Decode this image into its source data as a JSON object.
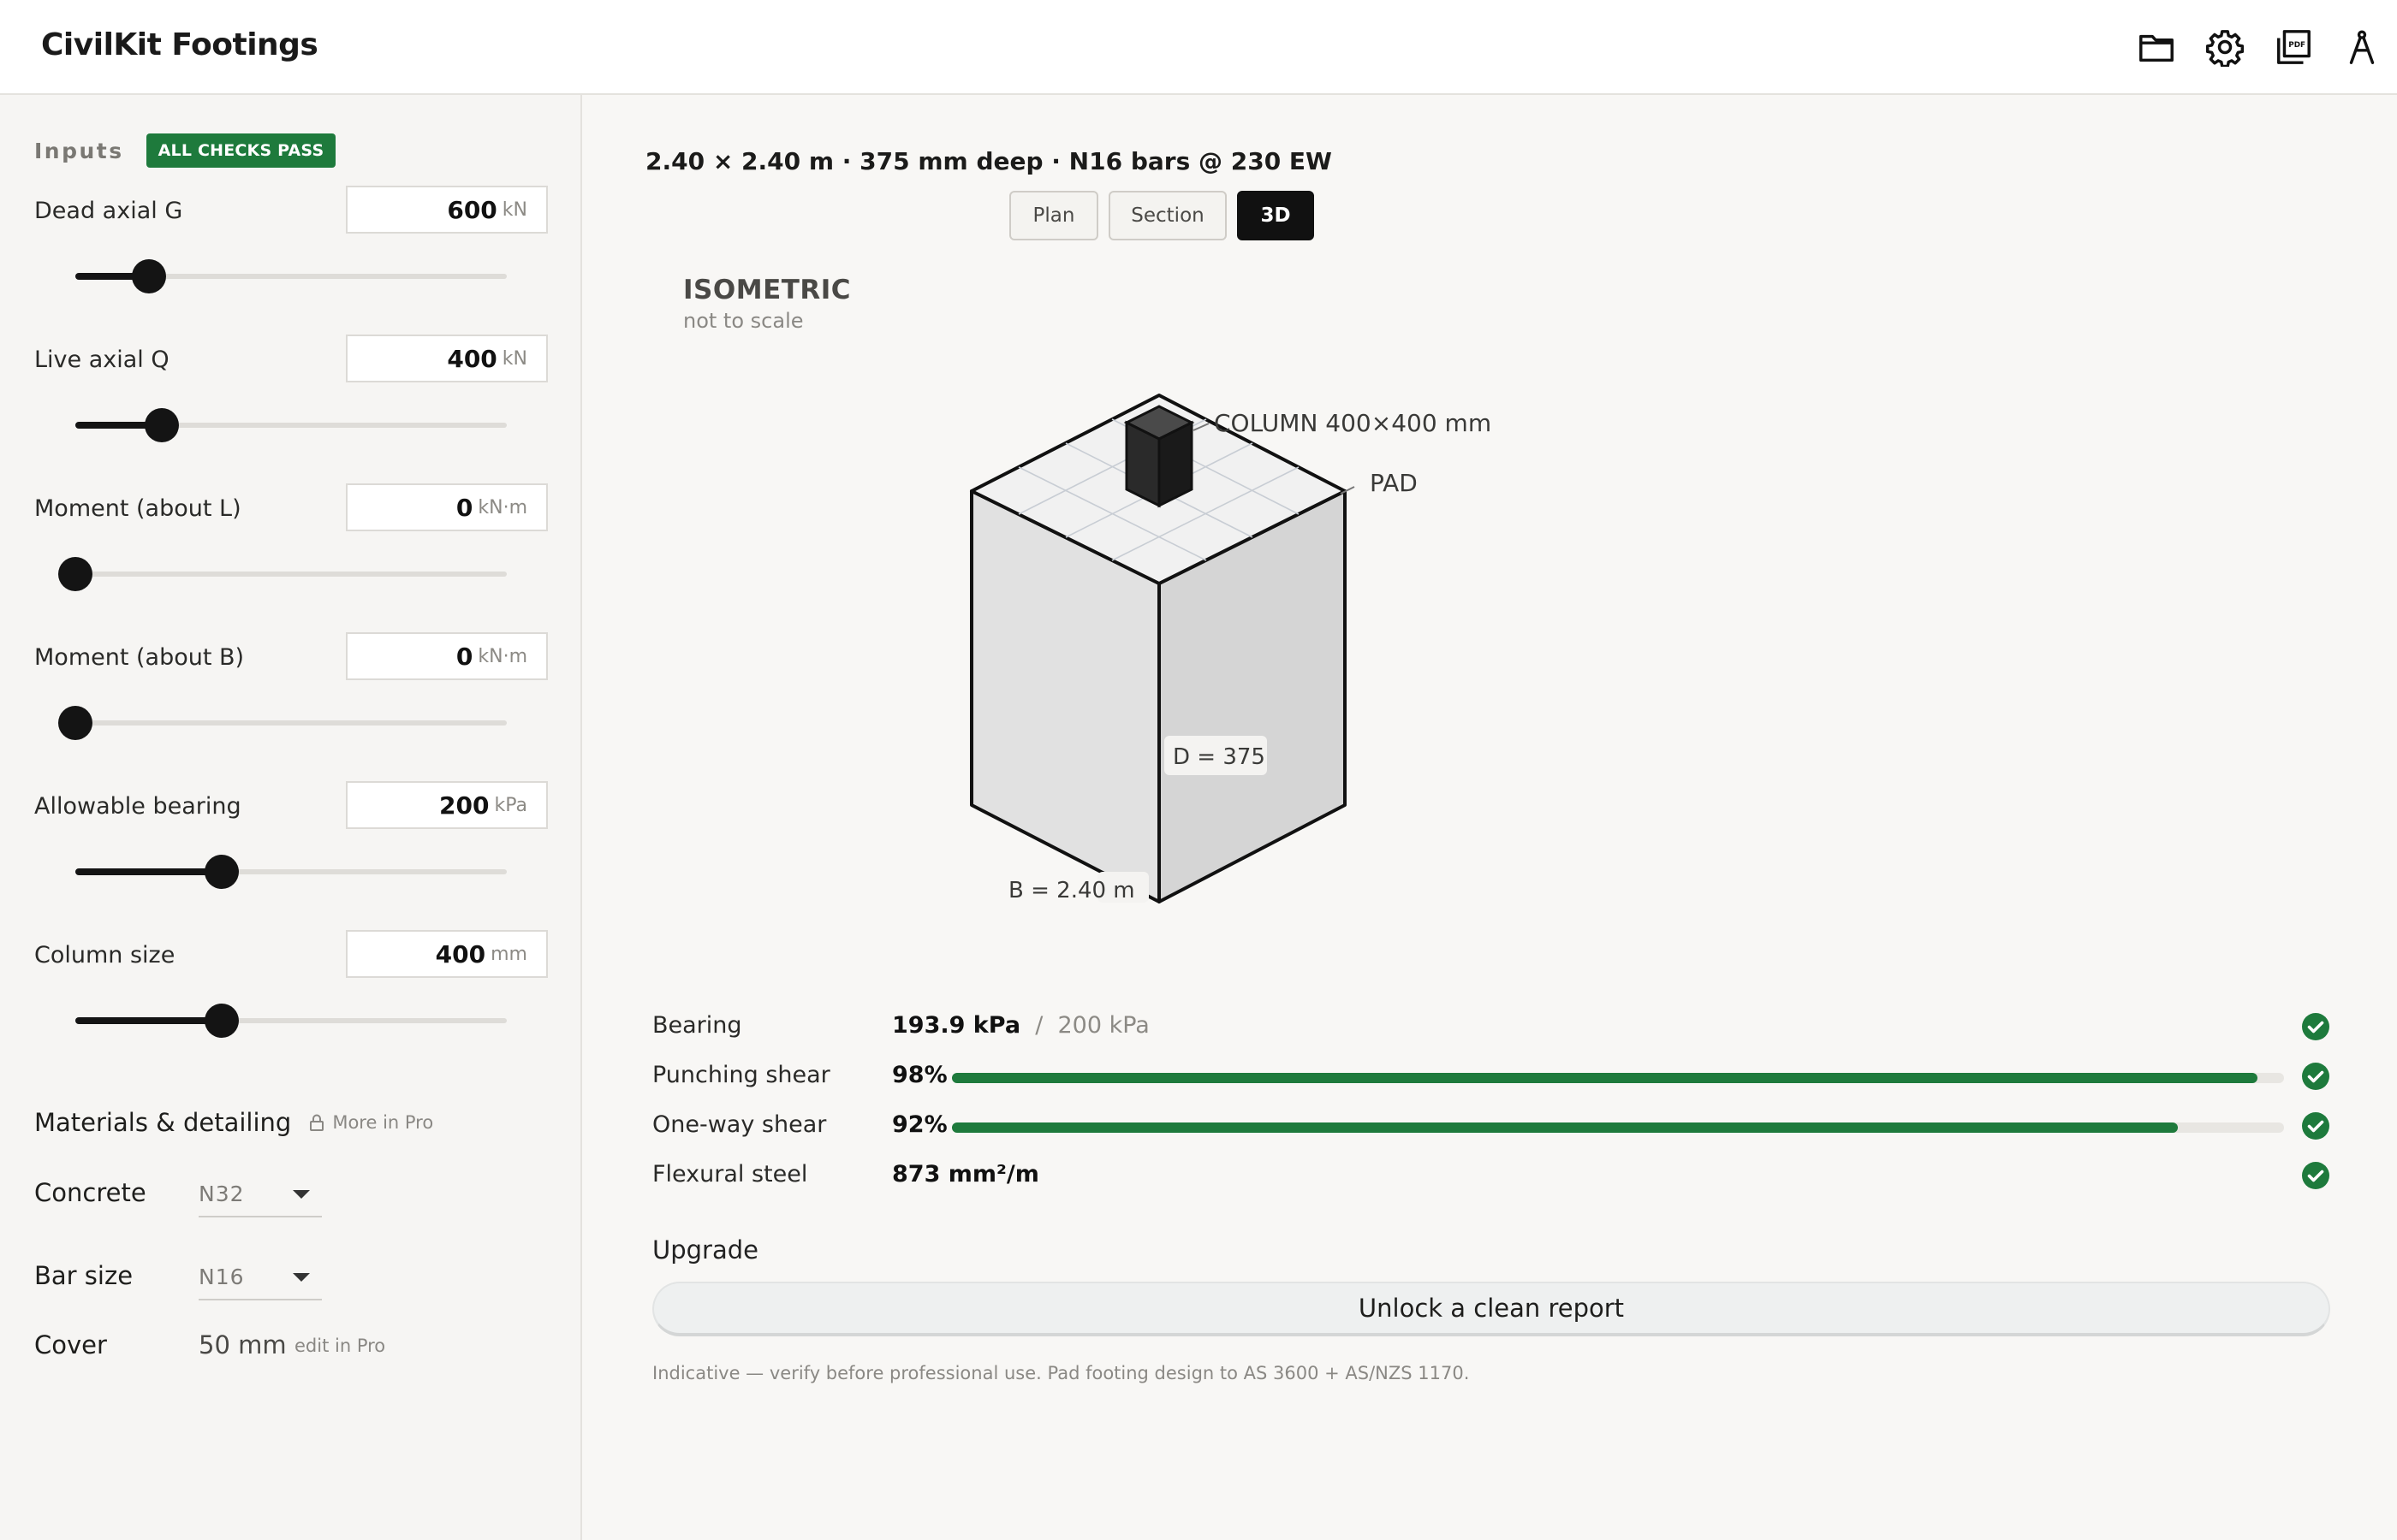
{
  "header": {
    "title": "CivilKit Footings",
    "icons": [
      "folder-icon",
      "gear-icon",
      "pdf-icon",
      "compass-icon"
    ]
  },
  "sidebar": {
    "inputs_title": "Inputs",
    "status_badge": "ALL CHECKS PASS",
    "fields": [
      {
        "label": "Dead axial G",
        "value": "600",
        "unit": "kN",
        "level": 0.17
      },
      {
        "label": "Live axial Q",
        "value": "400",
        "unit": "kN",
        "level": 0.2
      },
      {
        "label": "Moment (about L)",
        "value": "0",
        "unit": "kN·m",
        "level": 0
      },
      {
        "label": "Moment (about B)",
        "value": "0",
        "unit": "kN·m",
        "level": 0
      },
      {
        "label": "Allowable bearing",
        "value": "200",
        "unit": "kPa",
        "level": 0.34
      },
      {
        "label": "Column size",
        "value": "400",
        "unit": "mm",
        "level": 0.34
      }
    ],
    "materials": {
      "title": "Materials & detailing",
      "pro_note": "More in Pro",
      "concrete_label": "Concrete",
      "concrete_value": "N32",
      "bar_label": "Bar size",
      "bar_value": "N16",
      "cover_label": "Cover",
      "cover_value": "50 mm",
      "cover_note": "edit in Pro"
    }
  },
  "main": {
    "summary": "2.40 × 2.40 m · 375 mm deep · N16 bars @ 230 EW",
    "views": [
      "Plan",
      "Section",
      "3D"
    ],
    "active_view": "3D",
    "drawing": {
      "title": "ISOMETRIC",
      "subtitle": "not to scale",
      "column_label": "COLUMN 400×400 mm",
      "pad_label": "PAD",
      "depth_label": "D = 375",
      "width_label": "B = 2.40 m"
    },
    "checks": [
      {
        "label": "Bearing",
        "value": "193.9 kPa",
        "limit": "200 kPa",
        "pass": true
      },
      {
        "label": "Punching shear",
        "value": "98%",
        "ratio": 0.98,
        "pass": true
      },
      {
        "label": "One-way shear",
        "value": "92%",
        "ratio": 0.92,
        "pass": true
      },
      {
        "label": "Flexural steel",
        "value": "873 mm²/m",
        "pass": true
      }
    ],
    "upgrade_label": "Upgrade",
    "unlock_button": "Unlock a clean report",
    "disclaimer": "Indicative — verify before professional use. Pad footing design to AS 3600 + AS/NZS 1170."
  },
  "colors": {
    "accent_green": "#1e7a3c",
    "ink": "#111111"
  }
}
